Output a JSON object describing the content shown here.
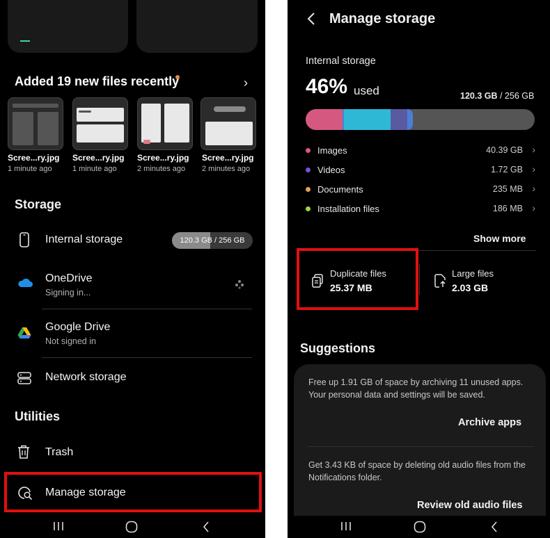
{
  "left": {
    "recent": {
      "title": "Added 19 new files recently",
      "files": [
        {
          "name": "Scree...ry.jpg",
          "time": "1 minute ago"
        },
        {
          "name": "Scree...ry.jpg",
          "time": "1 minute ago"
        },
        {
          "name": "Scree...ry.jpg",
          "time": "2 minutes ago"
        },
        {
          "name": "Scree...ry.jpg",
          "time": "2 minutes ago"
        }
      ]
    },
    "storage": {
      "heading": "Storage",
      "internal": {
        "label": "Internal storage",
        "usage": "120.3 GB / 256 GB",
        "usage_fraction": 0.47
      },
      "onedrive": {
        "label": "OneDrive",
        "status": "Signing in..."
      },
      "gdrive": {
        "label": "Google Drive",
        "status": "Not signed in"
      },
      "network": {
        "label": "Network storage"
      }
    },
    "utilities": {
      "heading": "Utilities",
      "trash": {
        "label": "Trash"
      },
      "manage": {
        "label": "Manage storage"
      }
    },
    "icons": {
      "search": "search-icon",
      "more": "more-vert-icon"
    }
  },
  "right": {
    "title": "Manage storage",
    "internal_label": "Internal storage",
    "percent": "46%",
    "used_word": "used",
    "used_bold": "120.3 GB",
    "used_total": " / 256 GB",
    "usage_fraction": 0.47,
    "categories": [
      {
        "name": "Images",
        "size": "40.39 GB",
        "color": "#e0567e",
        "bytes_gb": 40.39
      },
      {
        "name": "Videos",
        "size": "1.72 GB",
        "color": "#7b4fd8",
        "bytes_gb": 1.72
      },
      {
        "name": "Documents",
        "size": "235 MB",
        "color": "#e2a05c",
        "bytes_gb": 0.235
      },
      {
        "name": "Installation files",
        "size": "186 MB",
        "color": "#9ad83a",
        "bytes_gb": 0.186
      }
    ],
    "bar_colors": {
      "images": "#d4587f",
      "other": "#2eb8d6",
      "videos": "#5a5aa0",
      "apps": "#4a7fd6",
      "free": "#555555"
    },
    "show_more": "Show more",
    "duplicate": {
      "title": "Duplicate files",
      "value": "25.37 MB"
    },
    "large": {
      "title": "Large files",
      "value": "2.03 GB"
    },
    "suggestions_heading": "Suggestions",
    "suggestions": [
      {
        "text": "Free up 1.91 GB of space by archiving 11 unused apps. Your personal data and settings will be saved.",
        "action": "Archive apps"
      },
      {
        "text": "Get 3.43 KB of space by deleting old audio files from the Notifications folder.",
        "action": "Review old audio files"
      }
    ]
  },
  "highlight_color": "#e01010"
}
